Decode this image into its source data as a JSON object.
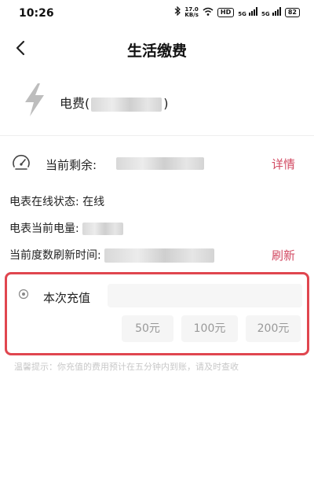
{
  "status_bar": {
    "time": "10:26",
    "net_speed_value": "17.0",
    "net_speed_unit": "KB/s",
    "hd_badge": "HD",
    "signal_1": "5G",
    "signal_2": "5G",
    "battery": "82"
  },
  "header": {
    "title": "生活缴费"
  },
  "fee": {
    "label_prefix": "电费(",
    "label_suffix": ")"
  },
  "balance": {
    "label": "当前剩余:",
    "detail_link": "详情"
  },
  "meter": {
    "online_status_label": "电表在线状态:",
    "online_status_value": "在线",
    "current_power_label": "电表当前电量:",
    "refresh_time_label": "当前度数刷新时间:",
    "refresh_link": "刷新"
  },
  "recharge": {
    "label": "本次充值",
    "input_value": "",
    "amounts": [
      "50元",
      "100元",
      "200元"
    ]
  },
  "hint": "温馨提示：你充值的费用预计在五分钟内到账，请及时查收",
  "colors": {
    "accent": "#d24a62",
    "highlight_border": "#e0464f"
  }
}
